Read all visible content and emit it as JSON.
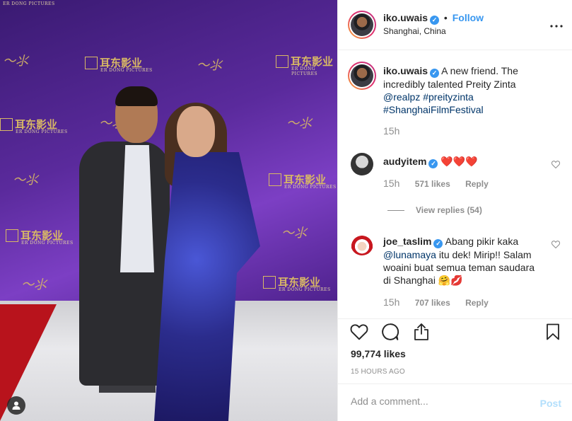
{
  "photo": {
    "backdrop_cn": "耳东影业",
    "backdrop_en": "ER DONG PICTURES"
  },
  "header": {
    "username": "iko.uwais",
    "separator": "•",
    "follow_label": "Follow",
    "location": "Shanghai, China",
    "more_icon": "more-dots-icon"
  },
  "caption": {
    "username": "iko.uwais",
    "text": "A new friend. The incredibly talented Preity Zinta",
    "mention": "@realpz",
    "tag1": "#preityzinta",
    "tag2": "#ShanghaiFilmFestival",
    "time": "15h"
  },
  "comments": [
    {
      "username": "audyitem",
      "text": "❤️❤️❤️",
      "time": "15h",
      "likes": "571 likes",
      "reply_label": "Reply"
    },
    {
      "username": "joe_taslim",
      "text_prefix": "Abang pikir kaka",
      "mention": "@lunamaya",
      "text_suffix": "itu dek! Mirip!! Salam woaini buat semua teman saudara di Shanghai 🤗💋",
      "time": "15h",
      "likes": "707 likes",
      "reply_label": "Reply"
    }
  ],
  "view_replies": "View replies (54)",
  "actions": {
    "likes": "99,774 likes",
    "post_time": "15 HOURS AGO"
  },
  "add_comment": {
    "placeholder": "Add a comment...",
    "post_label": "Post"
  },
  "colors": {
    "accent": "#3897f0",
    "link": "#003569",
    "muted": "#8e8e8e",
    "post_disabled": "#b2dffc"
  }
}
